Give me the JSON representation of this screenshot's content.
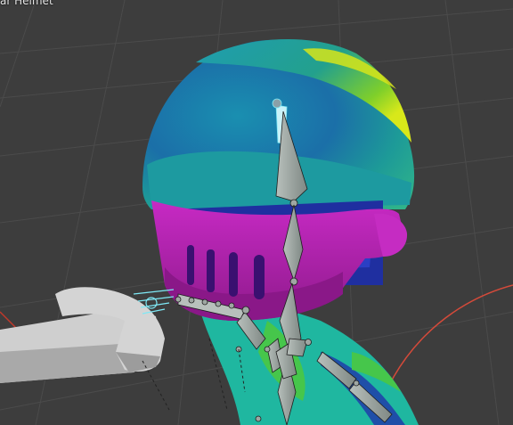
{
  "viewport": {
    "object_label": "Helmet",
    "header_prefix": "ar",
    "colors": {
      "background": "#3d3d3d",
      "grid": "#4a4a4a",
      "axis_x": "#c0392b",
      "helmet_top": "#1fa99a",
      "helmet_yellow": "#cde31a",
      "helmet_blue": "#1f4fa8",
      "visor": "#b01fae",
      "visor_dark": "#7a1378",
      "body_green": "#46c64b",
      "body_teal": "#1fb7a0",
      "bone": "#9fa7a3",
      "bone_selected": "#7ee8f5",
      "sword_grey": "#c9c9c9"
    }
  }
}
